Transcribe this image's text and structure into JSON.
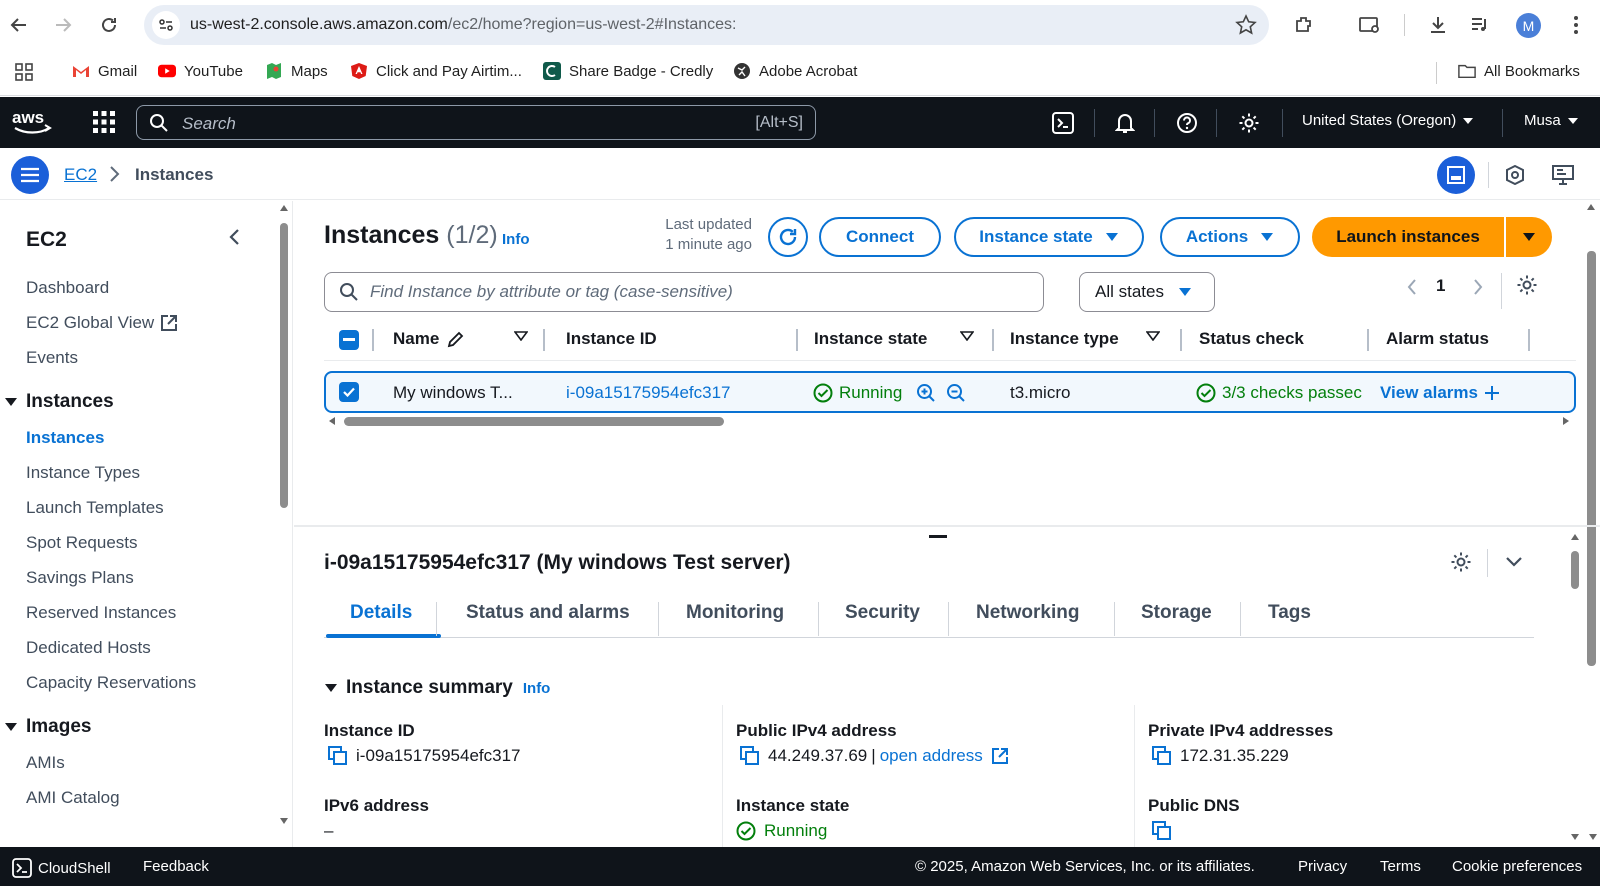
{
  "browser": {
    "url_host": "us-west-2.console.aws.amazon.com",
    "url_path": "/ec2/home?region=us-west-2#Instances:",
    "profile_initial": "M",
    "bookmarks": [
      "Gmail",
      "YouTube",
      "Maps",
      "Click and Pay Airtim...",
      "Share Badge - Credly",
      "Adobe Acrobat"
    ],
    "all_bookmarks": "All Bookmarks"
  },
  "topnav": {
    "search_placeholder": "Search",
    "search_shortcut": "[Alt+S]",
    "region": "United States (Oregon)",
    "user": "Musa"
  },
  "breadcrumb": {
    "service": "EC2",
    "current": "Instances"
  },
  "sidebar": {
    "title": "EC2",
    "top_items": [
      "Dashboard",
      "EC2 Global View",
      "Events"
    ],
    "instances_section": "Instances",
    "instances_items": [
      "Instances",
      "Instance Types",
      "Launch Templates",
      "Spot Requests",
      "Savings Plans",
      "Reserved Instances",
      "Dedicated Hosts",
      "Capacity Reservations"
    ],
    "images_section": "Images",
    "images_items": [
      "AMIs",
      "AMI Catalog"
    ]
  },
  "instances": {
    "title": "Instances",
    "count": "(1/2)",
    "info": "Info",
    "last_updated_1": "Last updated",
    "last_updated_2": "1 minute ago",
    "connect": "Connect",
    "instance_state_btn": "Instance state",
    "actions": "Actions",
    "launch": "Launch instances",
    "find_placeholder": "Find Instance by attribute or tag (case-sensitive)",
    "states_filter": "All states",
    "page": "1",
    "columns": [
      "Name",
      "Instance ID",
      "Instance state",
      "Instance type",
      "Status check",
      "Alarm status"
    ],
    "row": {
      "name": "My windows T...",
      "id": "i-09a15175954efc317",
      "state": "Running",
      "type": "t3.micro",
      "status_check": "3/3 checks passec",
      "alarm": "View alarms"
    }
  },
  "details": {
    "title": "i-09a15175954efc317 (My windows Test server)",
    "tabs": [
      "Details",
      "Status and alarms",
      "Monitoring",
      "Security",
      "Networking",
      "Storage",
      "Tags"
    ],
    "summary_title": "Instance summary",
    "summary_info": "Info",
    "instance_id_label": "Instance ID",
    "instance_id_value": "i-09a15175954efc317",
    "public_ipv4_label": "Public IPv4 address",
    "public_ipv4_value": "44.249.37.69",
    "ip_separator": "|",
    "open_address": "open address",
    "private_ipv4_label": "Private IPv4 addresses",
    "private_ipv4_value": "172.31.35.229",
    "ipv6_label": "IPv6 address",
    "ipv6_value": "–",
    "state_label": "Instance state",
    "state_value": "Running",
    "public_dns_label": "Public DNS"
  },
  "footer": {
    "cloudshell": "CloudShell",
    "feedback": "Feedback",
    "copyright": "© 2025, Amazon Web Services, Inc. or its affiliates.",
    "privacy": "Privacy",
    "terms": "Terms",
    "cookies": "Cookie preferences"
  },
  "colors": {
    "link": "#0972d3",
    "success": "#037f0c",
    "launch": "#ff9900",
    "nav_bg": "#0f141a"
  }
}
